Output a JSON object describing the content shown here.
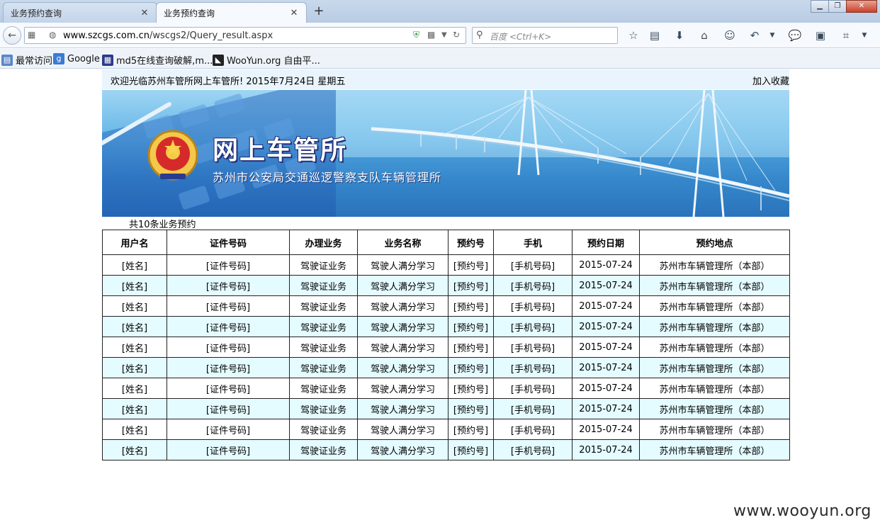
{
  "browser": {
    "tabs": [
      {
        "title": "业务预约查询",
        "active": false
      },
      {
        "title": "业务预约查询",
        "active": true
      }
    ],
    "new_tab": "+",
    "url_prefix": "www.szcgs.com.cn",
    "url_path": "/wscgs2/Query_result.aspx",
    "search_placeholder": "百度 <Ctrl+K>",
    "bookmarks": [
      {
        "label": "最常访问",
        "icon": "folder-icon"
      },
      {
        "label": "Google",
        "icon": "google-icon"
      },
      {
        "label": "md5在线查询破解,m...",
        "icon": "md5-icon"
      },
      {
        "label": "WooYun.org 自由平...",
        "icon": "wooyun-icon"
      }
    ]
  },
  "page": {
    "welcome": "欢迎光临苏州车管所网上车管所! 2015年7月24日 星期五",
    "bookmark_link": "加入收藏",
    "banner_title": "网上车管所",
    "banner_subtitle": "苏州市公安局交通巡逻警察支队车辆管理所",
    "count_text": "共10条业务预约",
    "watermark": "www.wooyun.org"
  },
  "table": {
    "headers": [
      "用户名",
      "证件号码",
      "办理业务",
      "业务名称",
      "预约号",
      "手机",
      "预约日期",
      "预约地点"
    ],
    "rows": [
      [
        "[姓名]",
        "[证件号码]",
        "驾驶证业务",
        "驾驶人满分学习",
        "[预约号]",
        "[手机号码]",
        "2015-07-24",
        "苏州市车辆管理所（本部）"
      ],
      [
        "[姓名]",
        "[证件号码]",
        "驾驶证业务",
        "驾驶人满分学习",
        "[预约号]",
        "[手机号码]",
        "2015-07-24",
        "苏州市车辆管理所（本部）"
      ],
      [
        "[姓名]",
        "[证件号码]",
        "驾驶证业务",
        "驾驶人满分学习",
        "[预约号]",
        "[手机号码]",
        "2015-07-24",
        "苏州市车辆管理所（本部）"
      ],
      [
        "[姓名]",
        "[证件号码]",
        "驾驶证业务",
        "驾驶人满分学习",
        "[预约号]",
        "[手机号码]",
        "2015-07-24",
        "苏州市车辆管理所（本部）"
      ],
      [
        "[姓名]",
        "[证件号码]",
        "驾驶证业务",
        "驾驶人满分学习",
        "[预约号]",
        "[手机号码]",
        "2015-07-24",
        "苏州市车辆管理所（本部）"
      ],
      [
        "[姓名]",
        "[证件号码]",
        "驾驶证业务",
        "驾驶人满分学习",
        "[预约号]",
        "[手机号码]",
        "2015-07-24",
        "苏州市车辆管理所（本部）"
      ],
      [
        "[姓名]",
        "[证件号码]",
        "驾驶证业务",
        "驾驶人满分学习",
        "[预约号]",
        "[手机号码]",
        "2015-07-24",
        "苏州市车辆管理所（本部）"
      ],
      [
        "[姓名]",
        "[证件号码]",
        "驾驶证业务",
        "驾驶人满分学习",
        "[预约号]",
        "[手机号码]",
        "2015-07-24",
        "苏州市车辆管理所（本部）"
      ],
      [
        "[姓名]",
        "[证件号码]",
        "驾驶证业务",
        "驾驶人满分学习",
        "[预约号]",
        "[手机号码]",
        "2015-07-24",
        "苏州市车辆管理所（本部）"
      ],
      [
        "[姓名]",
        "[证件号码]",
        "驾驶证业务",
        "驾驶人满分学习",
        "[预约号]",
        "[手机号码]",
        "2015-07-24",
        "苏州市车辆管理所（本部）"
      ]
    ]
  },
  "colors": {
    "alt_row": "#e4fbff",
    "banner_blue": "#2f7fc5",
    "title_outline": "#23307a"
  }
}
